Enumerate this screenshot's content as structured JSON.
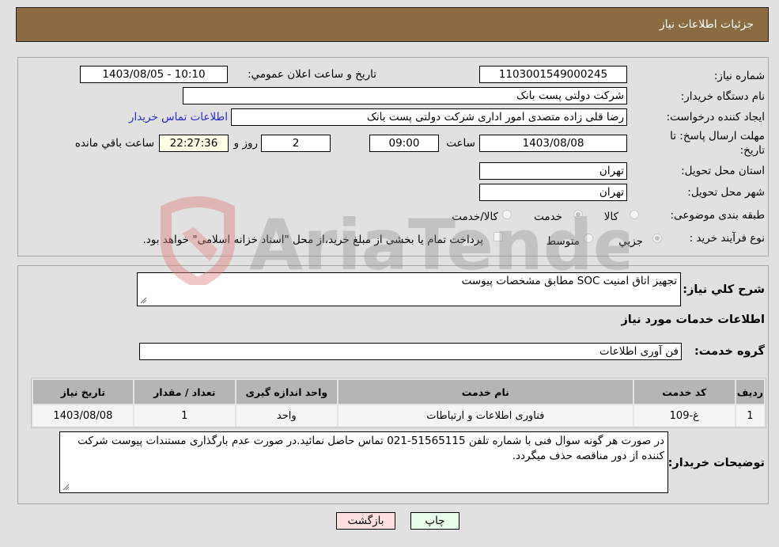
{
  "header": {
    "title": "جزئيات اطلاعات نياز"
  },
  "form": {
    "need_number": {
      "label": "شماره نياز:",
      "value": "1103001549000245"
    },
    "announce_datetime": {
      "label": "تاريخ و ساعت اعلان عمومي:",
      "value": "1403/08/05 - 10:10"
    },
    "buyer_org": {
      "label": "نام دستگاه خريدار:",
      "value": "شرکت دولتی پست بانک"
    },
    "requester": {
      "label": "ايجاد کننده درخواست:",
      "value": "رضا قلی زاده متصدی امور اداری شرکت دولتی پست بانک"
    },
    "buyer_contact_link": "اطلاعات تماس خريدار",
    "deadline": {
      "label_line1": "مهلت ارسال پاسخ: تا",
      "label_line2": "تاريخ:",
      "date": "1403/08/08",
      "time_label": "ساعت",
      "time": "09:00",
      "days": "2",
      "days_label": "روز و",
      "remaining": "22:27:36",
      "remaining_label": "ساعت باقي مانده"
    },
    "province": {
      "label": "استان محل تحويل:",
      "value": "تهران"
    },
    "city": {
      "label": "شهر محل تحويل:",
      "value": "تهران"
    },
    "category": {
      "label": "طبقه بندی موضوعی:",
      "options": [
        {
          "label": "کالا",
          "checked": false
        },
        {
          "label": "خدمت",
          "checked": true
        },
        {
          "label": "کالا/خدمت",
          "checked": false
        }
      ]
    },
    "purchase_process": {
      "label": "نوع فرآيند خريد :",
      "options": [
        {
          "label": "جزيي",
          "checked": true
        },
        {
          "label": "متوسط",
          "checked": false
        }
      ],
      "treasury_note": "پرداخت تمام يا بخشی از مبلغ خريد،از محل \"اسناد خزانه اسلامی\" خواهد بود.",
      "treasury_checked": false
    }
  },
  "details": {
    "description_label": "شرح کلي نياز:",
    "description_value": "تجهيز اتاق امنيت SOC مطابق مشخصات پيوست",
    "services_heading": "اطلاعات خدمات مورد نياز",
    "service_group_label": "گروه خدمت:",
    "service_group_value": "فن آوری اطلاعات",
    "table": {
      "headers": [
        "رديف",
        "کد خدمت",
        "نام خدمت",
        "واحد اندازه گيری",
        "تعداد / مقدار",
        "تاريخ نياز"
      ],
      "rows": [
        [
          "1",
          "غ-109",
          "فناوری اطلاعات و ارتباطات",
          "واحد",
          "1",
          "1403/08/08"
        ]
      ]
    },
    "buyer_notes_label": "توضيحات خريدار:",
    "buyer_notes_value": "در صورت هر گونه سوال فنی با شماره تلفن 51565115-021 تماس حاصل نمائيد.در صورت عدم بارگذاری مستندات پيوست شرکت کننده از دور مناقصه حذف ميگردد."
  },
  "buttons": {
    "print": "چاپ",
    "back": "بازگشت"
  },
  "watermark": {
    "text": "AriaTender.neT"
  },
  "colors": {
    "header_bg": "#8b6c42",
    "print_bg": "#eaffea",
    "back_bg": "#ffe0e0",
    "link": "#2a2ad0"
  }
}
